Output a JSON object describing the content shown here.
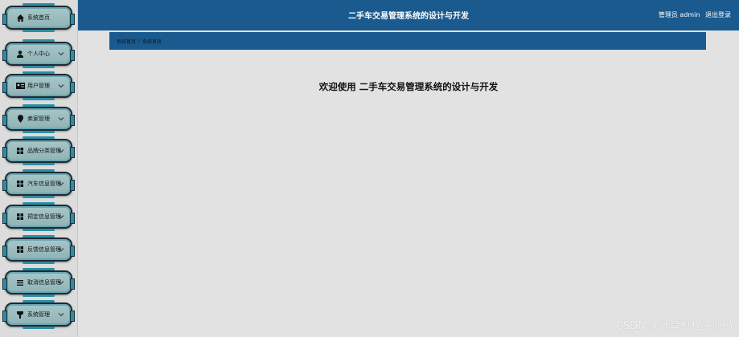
{
  "header": {
    "title": "二手车交易管理系统的设计与开发",
    "user_label": "管理员 admin",
    "logout_label": "退出登录"
  },
  "sidebar": {
    "items": [
      {
        "label": "系统首页",
        "icon": "home-icon"
      },
      {
        "label": "个人中心",
        "icon": "user-icon"
      },
      {
        "label": "用户管理",
        "icon": "id-card-icon"
      },
      {
        "label": "卖家管理",
        "icon": "location-pin-icon"
      },
      {
        "label": "品牌分类管理",
        "icon": "grid-icon"
      },
      {
        "label": "汽车信息管理",
        "icon": "grid-icon"
      },
      {
        "label": "预定信息管理",
        "icon": "grid-icon"
      },
      {
        "label": "反馈信息管理",
        "icon": "grid-icon"
      },
      {
        "label": "取消信息管理",
        "icon": "list-icon"
      },
      {
        "label": "系统管理",
        "icon": "shield-icon"
      }
    ]
  },
  "breadcrumb": {
    "root": "系统首页",
    "separator": "/",
    "current": "系统首页"
  },
  "welcome": {
    "prefix": "欢迎使用",
    "system_name": "二手车交易管理系统的设计与开发"
  },
  "watermark": "CSDN @计算机程序源码",
  "colors": {
    "header_bg": "#1b5a8e",
    "sidebar_item_bg": "#a7c7c9",
    "accent": "#2a8fa6",
    "page_bg": "#e2e2e2"
  }
}
